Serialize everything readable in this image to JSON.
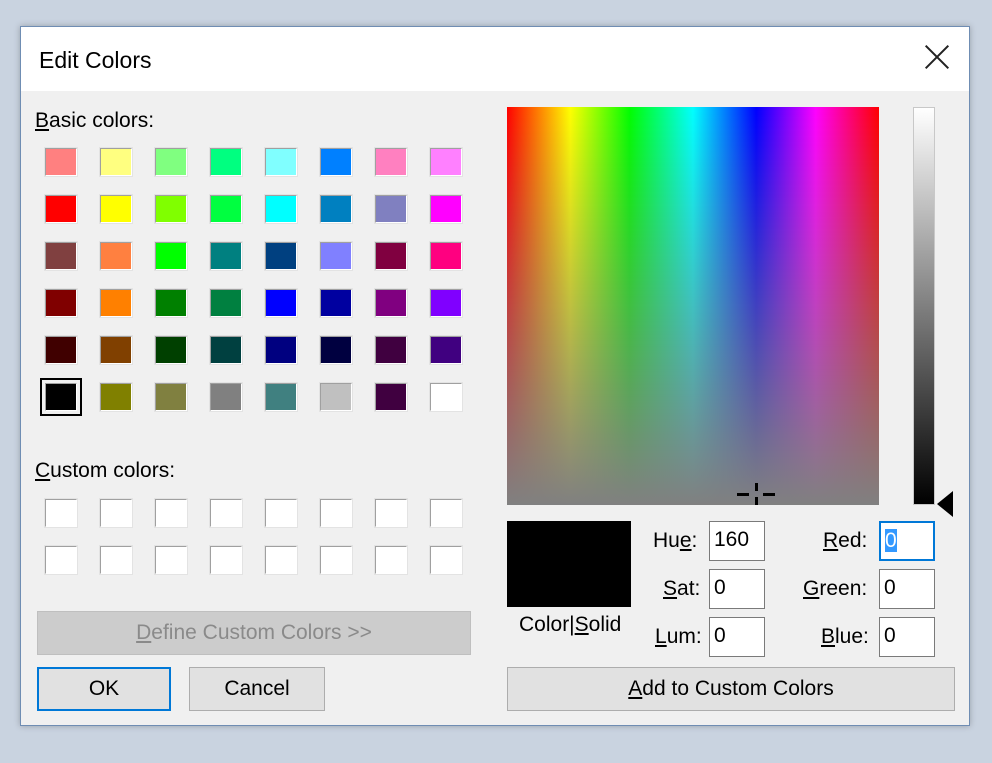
{
  "window": {
    "title": "Edit Colors"
  },
  "icons": {
    "close": "close-icon",
    "luminance_pointer": "triangle-left-icon",
    "crosshair": "crosshair-icon"
  },
  "basic_colors": {
    "label_accel": "B",
    "label_rest": "asic colors:",
    "rows": [
      [
        "#ff8080",
        "#ffff80",
        "#80ff80",
        "#00ff80",
        "#80ffff",
        "#0080ff",
        "#ff80c0",
        "#ff80ff"
      ],
      [
        "#ff0000",
        "#ffff00",
        "#80ff00",
        "#00ff40",
        "#00ffff",
        "#0080c0",
        "#8080c0",
        "#ff00ff"
      ],
      [
        "#804040",
        "#ff8040",
        "#00ff00",
        "#008080",
        "#004080",
        "#8080ff",
        "#800040",
        "#ff0080"
      ],
      [
        "#800000",
        "#ff8000",
        "#008000",
        "#008040",
        "#0000ff",
        "#0000a0",
        "#800080",
        "#8000ff"
      ],
      [
        "#400000",
        "#804000",
        "#004000",
        "#004040",
        "#000080",
        "#000040",
        "#400040",
        "#400080"
      ],
      [
        "#000000",
        "#808000",
        "#808040",
        "#808080",
        "#408080",
        "#c0c0c0",
        "#400040",
        "#ffffff"
      ]
    ],
    "selected_color": "#000000"
  },
  "custom_colors": {
    "label_accel": "C",
    "label_rest": "ustom colors:",
    "rows": [
      [
        "#ffffff",
        "#ffffff",
        "#ffffff",
        "#ffffff",
        "#ffffff",
        "#ffffff",
        "#ffffff",
        "#ffffff"
      ],
      [
        "#ffffff",
        "#ffffff",
        "#ffffff",
        "#ffffff",
        "#ffffff",
        "#ffffff",
        "#ffffff",
        "#ffffff"
      ]
    ]
  },
  "buttons": {
    "define_accel": "D",
    "define_rest": "efine Custom Colors >>",
    "ok": "OK",
    "cancel": "Cancel",
    "add_accel": "A",
    "add_rest": "dd to Custom Colors"
  },
  "preview": {
    "color_label": "Color|",
    "solid_accel": "S",
    "solid_rest": "olid",
    "color": "#000000"
  },
  "fields": {
    "hue": {
      "label_pre": "Hu",
      "label_accel": "e",
      "label_post": ":",
      "value": "160"
    },
    "sat": {
      "label_pre": "",
      "label_accel": "S",
      "label_post": "at:",
      "value": "0"
    },
    "lum": {
      "label_pre": "",
      "label_accel": "L",
      "label_post": "um:",
      "value": "0"
    },
    "red": {
      "label_pre": "",
      "label_accel": "R",
      "label_post": "ed:",
      "value": "0"
    },
    "green": {
      "label_pre": "",
      "label_accel": "G",
      "label_post": "reen:",
      "value": "0"
    },
    "blue": {
      "label_pre": "",
      "label_accel": "B",
      "label_post": "lue:",
      "value": "0"
    }
  },
  "colors": {
    "accent": "#0078d7",
    "dialog_bg": "#f0f0f0",
    "border": "#6f8db3"
  }
}
